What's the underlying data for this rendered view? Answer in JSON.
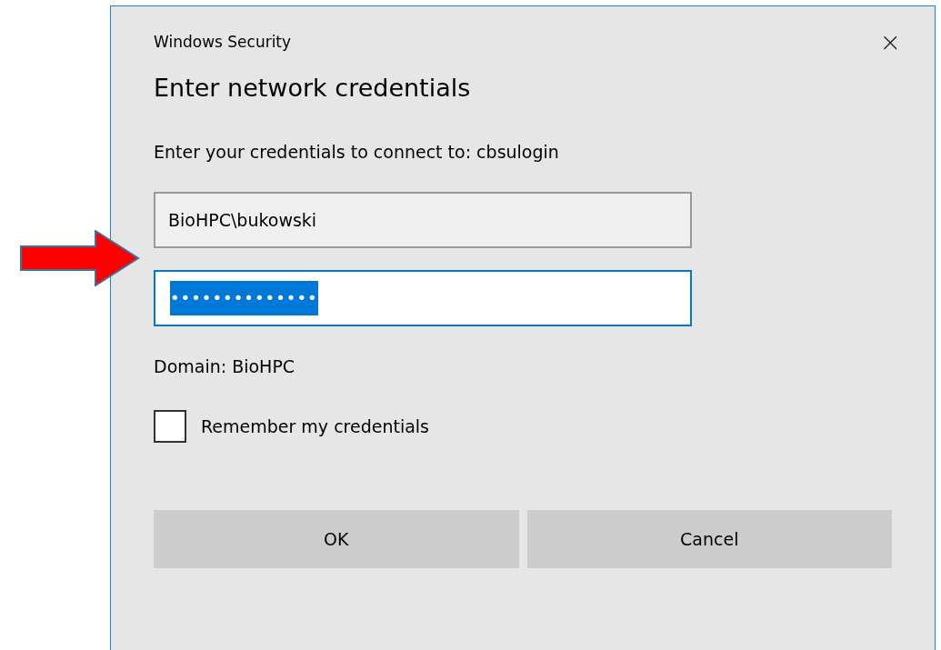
{
  "window": {
    "title": "Windows Security",
    "close": "×"
  },
  "heading": "Enter network credentials",
  "message": "Enter your credentials to connect to: cbsulogin",
  "username": {
    "value": "BioHPC\\bukowski",
    "focused": false
  },
  "password": {
    "value": "••••••••••••••",
    "focused": true,
    "selected": true
  },
  "domain": "Domain: BioHPC",
  "remember": {
    "label": "Remember my credentials",
    "checked": false
  },
  "buttons": [
    "OK",
    "Cancel"
  ],
  "annotation": {
    "kind": "arrow"
  }
}
